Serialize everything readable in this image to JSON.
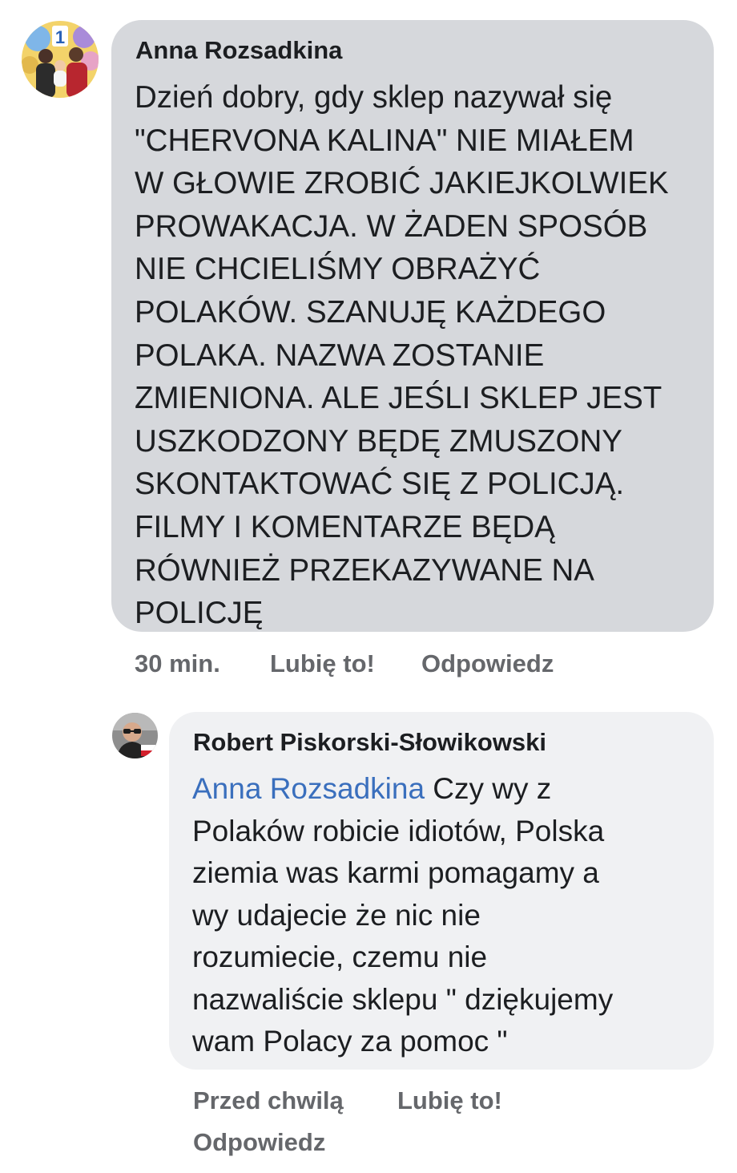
{
  "comments": [
    {
      "author": "Anna Rozsadkina",
      "avatar_icon": "family-photo-avatar",
      "text": "Dzień dobry, gdy sklep nazywał się\n\"CHERVONA KALINA\" NIE MIAŁEM\nW GŁOWIE ZROBIĆ JAKIEJKOLWIEK\nPROWAKACJA. W ŻADEN SPOSÓB\nNIE CHCIELIŚMY OBRAŻYĆ\nPOLAKÓW. SZANUJĘ KAŻDEGO\nPOLAKA. NAZWA ZOSTANIE\nZMIENIONA. ALE JEŚLI SKLEP JEST\nUSZKODZONY BĘDĘ ZMUSZONY\nSKONTAKTOWAĆ SIĘ Z POLICJĄ.\nFILMY I KOMENTARZE BĘDĄ\nRÓWNIEŻ PRZEKAZYWANE NA\nPOLICJĘ",
      "time": "30 min.",
      "like_label": "Lubię to!",
      "reply_label": "Odpowiedz",
      "bubble_color": "#d6d8dc"
    },
    {
      "author": "Robert Piskorski-Słowikowski",
      "avatar_icon": "man-with-glasses-avatar",
      "mention": "Anna Rozsadkina",
      "text": " Czy wy z\nPolaków robicie idiotów, Polska\nziemia was karmi pomagamy a\nwy udajecie że nic nie\nrozumiecie, czemu nie\nnazwaliście sklepu \" dziękujemy\nwam Polacy za pomoc \"",
      "time": "Przed chwilą",
      "like_label": "Lubię to!",
      "reply_label": "Odpowiedz",
      "bubble_color": "#f0f1f3",
      "mention_color": "#3a6fbd"
    }
  ]
}
